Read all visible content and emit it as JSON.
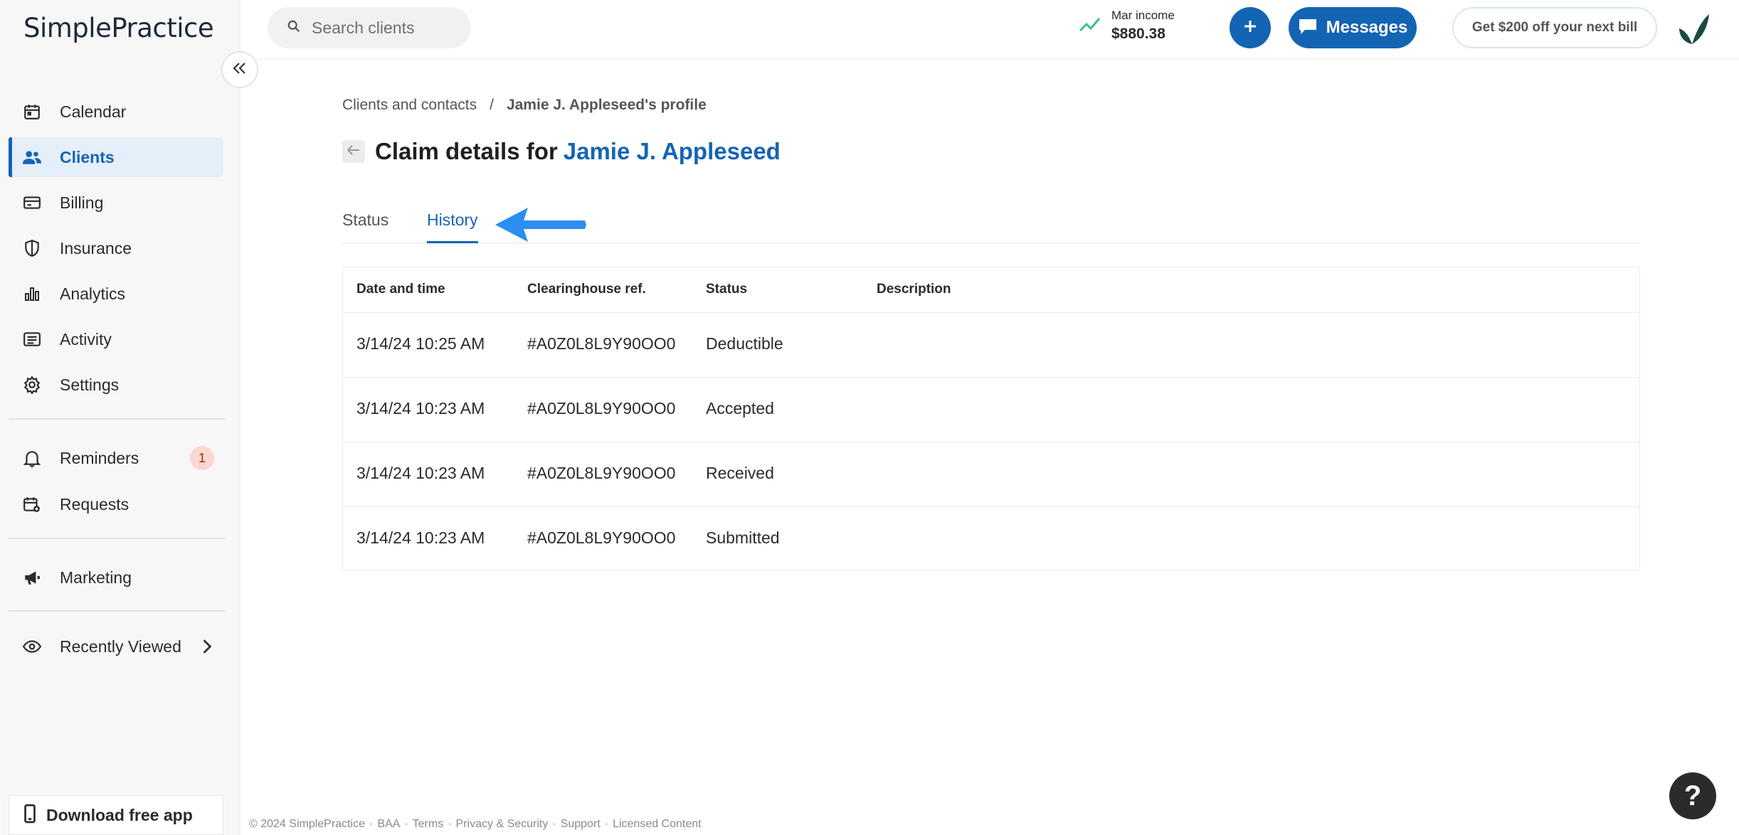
{
  "app": {
    "logo_text": "SimplePractice"
  },
  "search": {
    "placeholder": "Search clients"
  },
  "income": {
    "label": "Mar income",
    "amount": "$880.38"
  },
  "header": {
    "messages_label": "Messages",
    "promo_label": "Get $200 off your next bill"
  },
  "sidebar": {
    "items": [
      {
        "label": "Calendar",
        "icon": "calendar-icon"
      },
      {
        "label": "Clients",
        "icon": "users-icon"
      },
      {
        "label": "Billing",
        "icon": "credit-card-icon"
      },
      {
        "label": "Insurance",
        "icon": "shield-icon"
      },
      {
        "label": "Analytics",
        "icon": "bar-chart-icon"
      },
      {
        "label": "Activity",
        "icon": "list-icon"
      },
      {
        "label": "Settings",
        "icon": "gear-icon"
      },
      {
        "label": "Reminders",
        "icon": "bell-icon",
        "badge": "1"
      },
      {
        "label": "Requests",
        "icon": "calendar-plus-icon"
      },
      {
        "label": "Marketing",
        "icon": "megaphone-icon"
      },
      {
        "label": "Recently Viewed",
        "icon": "eye-icon"
      }
    ],
    "active": "Clients",
    "download_label": "Download free app"
  },
  "breadcrumb": {
    "parent": "Clients and contacts",
    "separator": "/",
    "current": "Jamie J. Appleseed's profile"
  },
  "page": {
    "title_prefix": "Claim details for",
    "client_name": "Jamie J. Appleseed"
  },
  "tabs": [
    {
      "label": "Status"
    },
    {
      "label": "History"
    }
  ],
  "active_tab": "History",
  "table": {
    "columns": [
      "Date and time",
      "Clearinghouse ref.",
      "Status",
      "Description"
    ],
    "rows": [
      [
        "3/14/24 10:25 AM",
        "#A0Z0L8L9Y90OO0",
        "Deductible",
        ""
      ],
      [
        "3/14/24 10:23 AM",
        "#A0Z0L8L9Y90OO0",
        "Accepted",
        ""
      ],
      [
        "3/14/24 10:23 AM",
        "#A0Z0L8L9Y90OO0",
        "Received",
        ""
      ],
      [
        "3/14/24 10:23 AM",
        "#A0Z0L8L9Y90OO0",
        "Submitted",
        ""
      ]
    ]
  },
  "footer": {
    "copyright": "© 2024 SimplePractice",
    "links": [
      "BAA",
      "Terms",
      "Privacy & Security",
      "Support",
      "Licensed Content"
    ]
  },
  "help": {
    "label": "?"
  },
  "colors": {
    "accent": "#1464b4",
    "annotation_arrow": "#2b8ef0",
    "badge_bg": "#fcd6cf"
  }
}
